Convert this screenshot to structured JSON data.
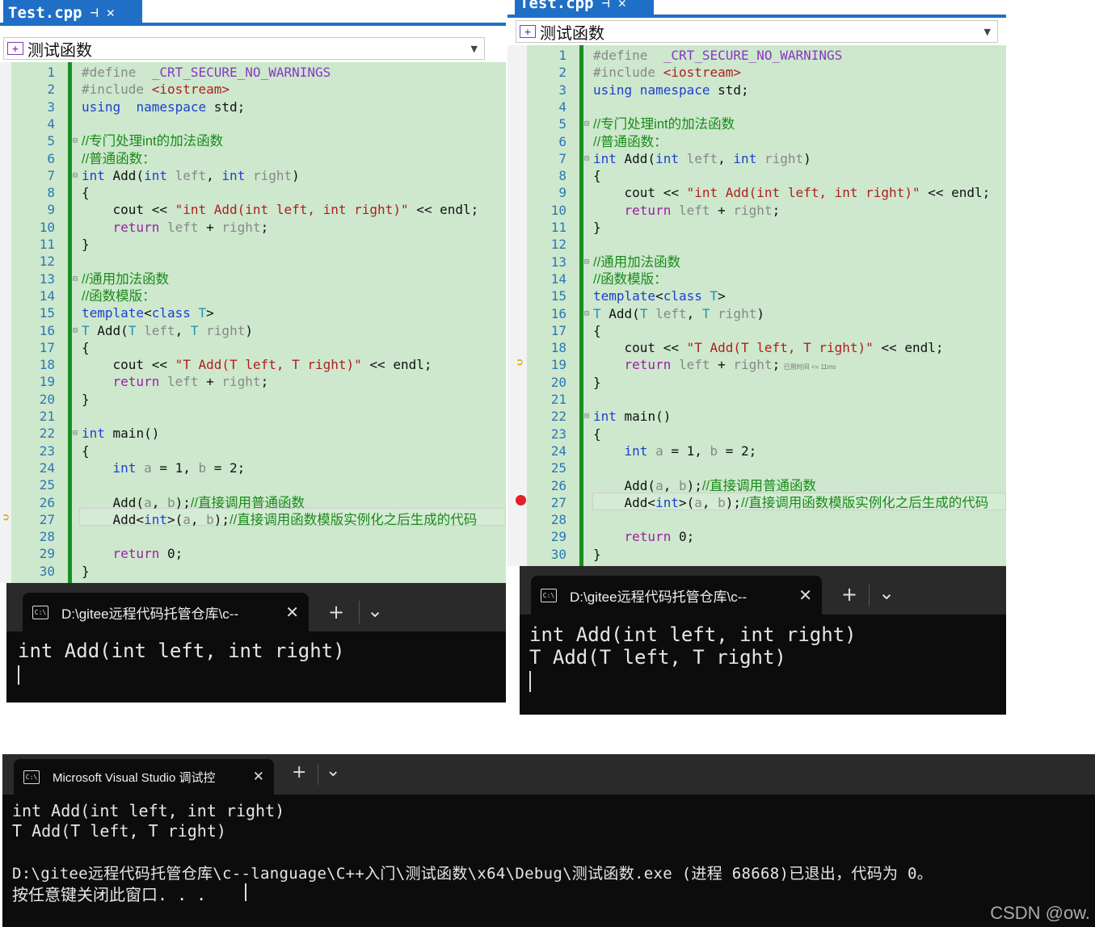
{
  "left": {
    "file_tab": "Test.cpp",
    "nav_scope": "测试函数",
    "terminal_tab": "D:\\gitee远程代码托管仓库\\c--",
    "terminal_output": [
      "int Add(int left, int right)"
    ]
  },
  "right": {
    "file_tab": "Test.cpp",
    "nav_scope": "测试函数",
    "terminal_tab": "D:\\gitee远程代码托管仓库\\c--",
    "terminal_output": [
      "int Add(int left, int right)",
      "T Add(T left, T right)"
    ],
    "perf_hint": "已用时间 <= 11ms"
  },
  "bottom": {
    "terminal_tab": "Microsoft Visual Studio 调试控",
    "output": [
      "int Add(int left, int right)",
      "T Add(T left, T right)",
      "",
      "D:\\gitee远程代码托管仓库\\c--language\\C++入门\\测试函数\\x64\\Debug\\测试函数.exe (进程 68668)已退出，代码为 0。",
      "按任意键关闭此窗口. . ."
    ],
    "watermark": "CSDN @ow."
  },
  "icons": {
    "pin": "pin-icon",
    "close": "close-icon",
    "new_tab": "plus-icon",
    "dropdown": "chevron-down-icon",
    "console": "console-icon",
    "scope": "scope-icon"
  },
  "colors": {
    "vs_blue": "#1f6fc6",
    "editor_green": "#cde8cd",
    "change_bar": "#17901f",
    "breakpoint": "#e41e2a",
    "terminal_bg": "#0c0c0c"
  },
  "code_left": [
    {
      "n": "1",
      "t": [
        [
          "pp",
          "#define "
        ],
        [
          "mac",
          " _CRT_SECURE_NO_WARNINGS"
        ]
      ]
    },
    {
      "n": "2",
      "t": [
        [
          "pp",
          "#include "
        ],
        [
          "str",
          "<iostream>"
        ]
      ]
    },
    {
      "n": "3",
      "t": [
        [
          "kw",
          "using"
        ],
        [
          "",
          "  "
        ],
        [
          "kw",
          "namespace"
        ],
        [
          "",
          " std;"
        ]
      ]
    },
    {
      "n": "4",
      "t": []
    },
    {
      "n": "5",
      "t": [
        [
          "cm",
          "//专门处理int的加法函数"
        ]
      ]
    },
    {
      "n": "6",
      "t": [
        [
          "cm",
          "//普通函数："
        ]
      ]
    },
    {
      "n": "7",
      "t": [
        [
          "kw",
          "int"
        ],
        [
          "",
          " Add("
        ],
        [
          "kw",
          "int"
        ],
        [
          "par",
          " left"
        ],
        [
          "",
          ", "
        ],
        [
          "kw",
          "int"
        ],
        [
          "par",
          " right"
        ],
        [
          "",
          ")"
        ]
      ]
    },
    {
      "n": "8",
      "t": [
        [
          "",
          "{"
        ]
      ]
    },
    {
      "n": "9",
      "t": [
        [
          "",
          "    cout << "
        ],
        [
          "str",
          "\"int Add(int left, int right)\""
        ],
        [
          "",
          " << endl;"
        ]
      ]
    },
    {
      "n": "10",
      "t": [
        [
          "",
          "    "
        ],
        [
          "ret",
          "return"
        ],
        [
          "par",
          " left"
        ],
        [
          "",
          " + "
        ],
        [
          "par",
          "right"
        ],
        [
          "",
          ";"
        ]
      ]
    },
    {
      "n": "11",
      "t": [
        [
          "",
          "}"
        ]
      ]
    },
    {
      "n": "12",
      "t": []
    },
    {
      "n": "13",
      "t": [
        [
          "cm",
          "//通用加法函数"
        ]
      ]
    },
    {
      "n": "14",
      "t": [
        [
          "cm",
          "//函数模版："
        ]
      ]
    },
    {
      "n": "15",
      "t": [
        [
          "kw",
          "template"
        ],
        [
          "",
          "<"
        ],
        [
          "kw",
          "class"
        ],
        [
          "ty",
          " T"
        ],
        [
          "",
          ">"
        ]
      ]
    },
    {
      "n": "16",
      "t": [
        [
          "ty",
          "T"
        ],
        [
          "",
          " Add("
        ],
        [
          "ty",
          "T"
        ],
        [
          "par",
          " left"
        ],
        [
          "",
          ", "
        ],
        [
          "ty",
          "T"
        ],
        [
          "par",
          " right"
        ],
        [
          "",
          ")"
        ]
      ]
    },
    {
      "n": "17",
      "t": [
        [
          "",
          "{"
        ]
      ]
    },
    {
      "n": "18",
      "t": [
        [
          "",
          "    cout << "
        ],
        [
          "str",
          "\"T Add(T left, T right)\""
        ],
        [
          "",
          " << endl;"
        ]
      ]
    },
    {
      "n": "19",
      "t": [
        [
          "",
          "    "
        ],
        [
          "ret",
          "return"
        ],
        [
          "par",
          " left"
        ],
        [
          "",
          " + "
        ],
        [
          "par",
          "right"
        ],
        [
          "",
          ";"
        ]
      ]
    },
    {
      "n": "20",
      "t": [
        [
          "",
          "}"
        ]
      ]
    },
    {
      "n": "21",
      "t": []
    },
    {
      "n": "22",
      "t": [
        [
          "kw",
          "int"
        ],
        [
          "",
          " main()"
        ]
      ]
    },
    {
      "n": "23",
      "t": [
        [
          "",
          "{"
        ]
      ]
    },
    {
      "n": "24",
      "t": [
        [
          "",
          "    "
        ],
        [
          "kw",
          "int"
        ],
        [
          "par",
          " a"
        ],
        [
          "",
          " = 1, "
        ],
        [
          "par",
          "b"
        ],
        [
          "",
          " = 2;"
        ]
      ]
    },
    {
      "n": "25",
      "t": []
    },
    {
      "n": "26",
      "t": [
        [
          "",
          "    Add("
        ],
        [
          "par",
          "a"
        ],
        [
          "",
          ", "
        ],
        [
          "par",
          "b"
        ],
        [
          "",
          ");"
        ],
        [
          "cm",
          "//直接调用普通函数"
        ]
      ]
    },
    {
      "n": "27",
      "t": [
        [
          "",
          "    Add<"
        ],
        [
          "kw",
          "int"
        ],
        [
          "",
          ">("
        ],
        [
          "par",
          "a"
        ],
        [
          "",
          ", "
        ],
        [
          "par",
          "b"
        ],
        [
          "",
          ");"
        ],
        [
          "cm",
          "//直接调用函数模版实例化之后生成的代码"
        ]
      ]
    },
    {
      "n": "28",
      "t": []
    },
    {
      "n": "29",
      "t": [
        [
          "",
          "    "
        ],
        [
          "ret",
          "return"
        ],
        [
          "",
          " 0;"
        ]
      ]
    },
    {
      "n": "30",
      "t": [
        [
          "",
          "}"
        ]
      ]
    }
  ],
  "code_right": [
    {
      "n": "1",
      "t": [
        [
          "pp",
          "#define "
        ],
        [
          "mac",
          " _CRT_SECURE_NO_WARNINGS"
        ]
      ]
    },
    {
      "n": "2",
      "t": [
        [
          "pp",
          "#include "
        ],
        [
          "str",
          "<iostream>"
        ]
      ]
    },
    {
      "n": "3",
      "t": [
        [
          "kw",
          "using"
        ],
        [
          "",
          ""
        ],
        [
          "kw",
          " namespace"
        ],
        [
          "",
          " std;"
        ]
      ]
    },
    {
      "n": "4",
      "t": []
    },
    {
      "n": "5",
      "t": [
        [
          "cm",
          "//专门处理int的加法函数"
        ]
      ]
    },
    {
      "n": "6",
      "t": [
        [
          "cm",
          "//普通函数："
        ]
      ]
    },
    {
      "n": "7",
      "t": [
        [
          "kw",
          "int"
        ],
        [
          "",
          " Add("
        ],
        [
          "kw",
          "int"
        ],
        [
          "par",
          " left"
        ],
        [
          "",
          ", "
        ],
        [
          "kw",
          "int"
        ],
        [
          "par",
          " right"
        ],
        [
          "",
          ")"
        ]
      ]
    },
    {
      "n": "8",
      "t": [
        [
          "",
          "{"
        ]
      ]
    },
    {
      "n": "9",
      "t": [
        [
          "",
          "    cout << "
        ],
        [
          "str",
          "\"int Add(int left, int right)\""
        ],
        [
          "",
          " << endl;"
        ]
      ]
    },
    {
      "n": "10",
      "t": [
        [
          "",
          "    "
        ],
        [
          "ret",
          "return"
        ],
        [
          "par",
          " left"
        ],
        [
          "",
          " + "
        ],
        [
          "par",
          "right"
        ],
        [
          "",
          ";"
        ]
      ]
    },
    {
      "n": "11",
      "t": [
        [
          "",
          "}"
        ]
      ]
    },
    {
      "n": "12",
      "t": []
    },
    {
      "n": "13",
      "t": [
        [
          "cm",
          "//通用加法函数"
        ]
      ]
    },
    {
      "n": "14",
      "t": [
        [
          "cm",
          "//函数模版："
        ]
      ]
    },
    {
      "n": "15",
      "t": [
        [
          "kw",
          "template"
        ],
        [
          "",
          "<"
        ],
        [
          "kw",
          "class"
        ],
        [
          "ty",
          " T"
        ],
        [
          "",
          ">"
        ]
      ]
    },
    {
      "n": "16",
      "t": [
        [
          "ty",
          "T"
        ],
        [
          "",
          " Add("
        ],
        [
          "ty",
          "T"
        ],
        [
          "par",
          " left"
        ],
        [
          "",
          ", "
        ],
        [
          "ty",
          "T"
        ],
        [
          "par",
          " right"
        ],
        [
          "",
          ")"
        ]
      ]
    },
    {
      "n": "17",
      "t": [
        [
          "",
          "{"
        ]
      ]
    },
    {
      "n": "18",
      "t": [
        [
          "",
          "    cout << "
        ],
        [
          "str",
          "\"T Add(T left, T right)\""
        ],
        [
          "",
          " << endl;"
        ]
      ]
    },
    {
      "n": "19",
      "t": [
        [
          "",
          "    "
        ],
        [
          "ret",
          "return"
        ],
        [
          "par",
          " left"
        ],
        [
          "",
          " + "
        ],
        [
          "par",
          "right"
        ],
        [
          "",
          ";"
        ]
      ]
    },
    {
      "n": "20",
      "t": [
        [
          "",
          "}"
        ]
      ]
    },
    {
      "n": "21",
      "t": []
    },
    {
      "n": "22",
      "t": [
        [
          "kw",
          "int"
        ],
        [
          "",
          " main()"
        ]
      ]
    },
    {
      "n": "23",
      "t": [
        [
          "",
          "{"
        ]
      ]
    },
    {
      "n": "24",
      "t": [
        [
          "",
          "    "
        ],
        [
          "kw",
          "int"
        ],
        [
          "par",
          " a"
        ],
        [
          "",
          " = 1, "
        ],
        [
          "par",
          "b"
        ],
        [
          "",
          " = 2;"
        ]
      ]
    },
    {
      "n": "25",
      "t": []
    },
    {
      "n": "26",
      "t": [
        [
          "",
          "    Add("
        ],
        [
          "par",
          "a"
        ],
        [
          "",
          ", "
        ],
        [
          "par",
          "b"
        ],
        [
          "",
          ");"
        ],
        [
          "cm",
          "//直接调用普通函数"
        ]
      ]
    },
    {
      "n": "27",
      "t": [
        [
          "",
          "    Add<"
        ],
        [
          "kw",
          "int"
        ],
        [
          "",
          ">("
        ],
        [
          "par",
          "a"
        ],
        [
          "",
          ", "
        ],
        [
          "par",
          "b"
        ],
        [
          "",
          ");"
        ],
        [
          "cm",
          "//直接调用函数模版实例化之后生成的代码"
        ]
      ]
    },
    {
      "n": "28",
      "t": []
    },
    {
      "n": "29",
      "t": [
        [
          "",
          "    "
        ],
        [
          "ret",
          "return"
        ],
        [
          "",
          " 0;"
        ]
      ]
    },
    {
      "n": "30",
      "t": [
        [
          "",
          "}"
        ]
      ]
    }
  ]
}
